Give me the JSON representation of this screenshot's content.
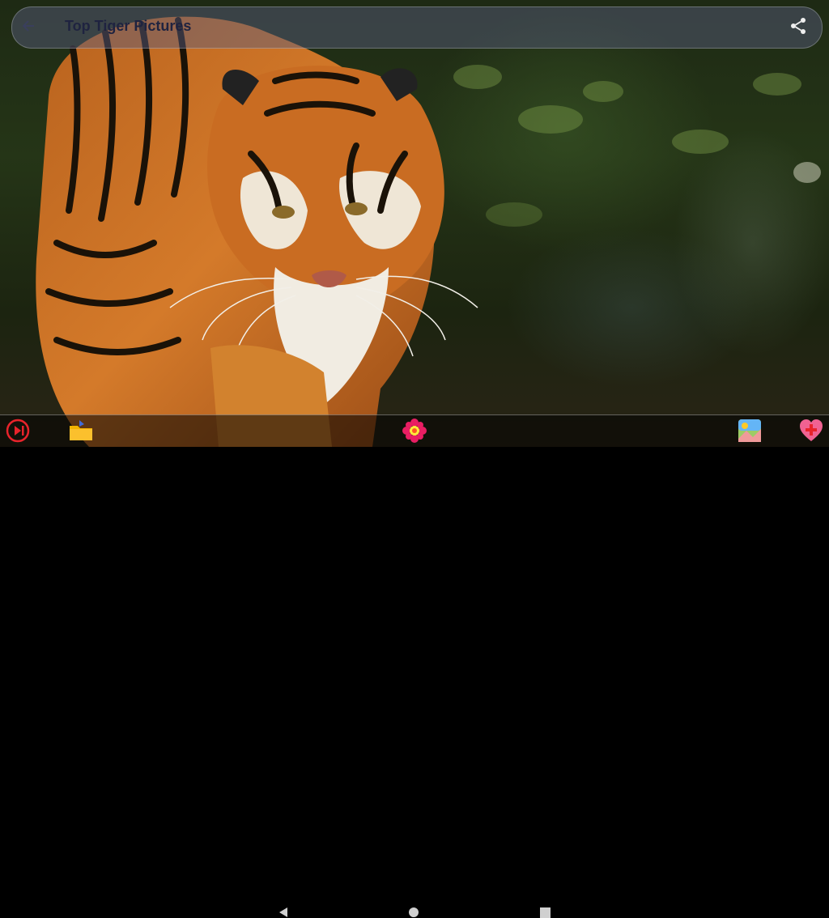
{
  "app": {
    "title": "Top Tiger Pictures"
  },
  "image": {
    "subject": "tiger-photo"
  },
  "topbar": {
    "back_icon": "arrow-left-icon",
    "share_icon": "share-icon"
  },
  "bottombar": {
    "icons": [
      "slideshow-play-icon",
      "folder-icon",
      "flower-settings-icon",
      "gallery-icon",
      "heart-plus-icon"
    ]
  },
  "navbar": {
    "icons": [
      "nav-back-icon",
      "nav-home-icon",
      "nav-recents-icon"
    ]
  },
  "colors": {
    "play_red": "#e8232b",
    "heart_pink": "#f06292",
    "accent_blue": "#3f6bd8"
  }
}
